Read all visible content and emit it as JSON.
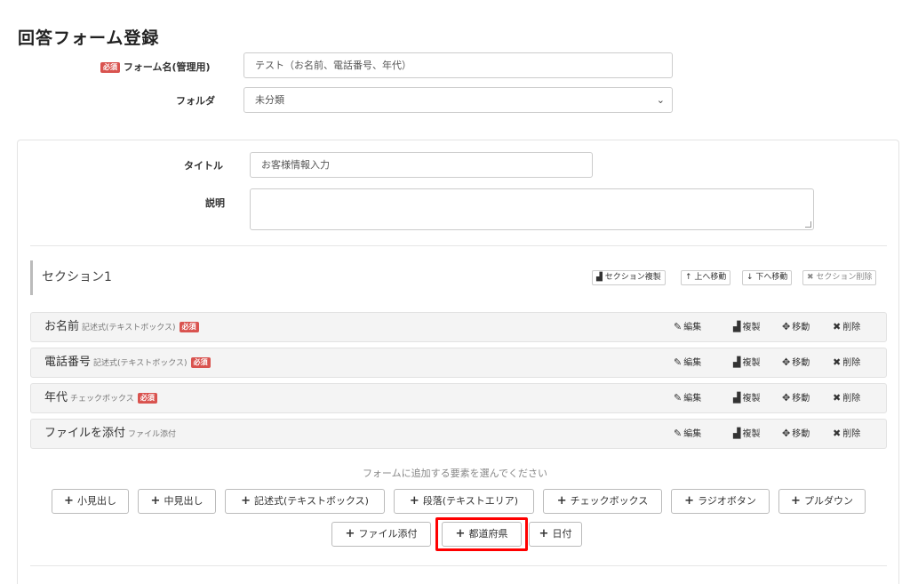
{
  "page": {
    "title": "回答フォーム登録"
  },
  "required_badge": "必須",
  "form_name": {
    "label": "フォーム名(管理用)",
    "value": "テスト（お名前、電話番号、年代）"
  },
  "folder": {
    "label": "フォルダ",
    "value": "未分類",
    "chevron": "⌄"
  },
  "form": {
    "title_label": "タイトル",
    "title_value": "お客様情報入力",
    "description_label": "説明",
    "description_value": ""
  },
  "section": {
    "name": "セクション1",
    "buttons": {
      "duplicate": "セクション複製",
      "move_up": "上へ移動",
      "move_down": "下へ移動",
      "delete": "セクション削除"
    }
  },
  "items": [
    {
      "title": "お名前",
      "type": "記述式(テキストボックス)",
      "required": true
    },
    {
      "title": "電話番号",
      "type": "記述式(テキストボックス)",
      "required": true
    },
    {
      "title": "年代",
      "type": "チェックボックス",
      "required": true
    },
    {
      "title": "ファイルを添付",
      "type": "ファイル添付",
      "required": false
    }
  ],
  "item_actions": {
    "edit": "編集",
    "copy": "複製",
    "move": "移動",
    "delete": "削除"
  },
  "add_hint": "フォームに追加する要素を選んでください",
  "add_buttons": {
    "small_heading": "小見出し",
    "medium_heading": "中見出し",
    "textbox": "記述式(テキストボックス)",
    "textarea": "段落(テキストエリア)",
    "checkbox": "チェックボックス",
    "radio": "ラジオボタン",
    "pulldown": "プルダウン",
    "file": "ファイル添付",
    "prefecture": "都道府県",
    "date": "日付"
  },
  "colors": {
    "required_badge": "#d9534f",
    "highlight": "#ff0000"
  }
}
